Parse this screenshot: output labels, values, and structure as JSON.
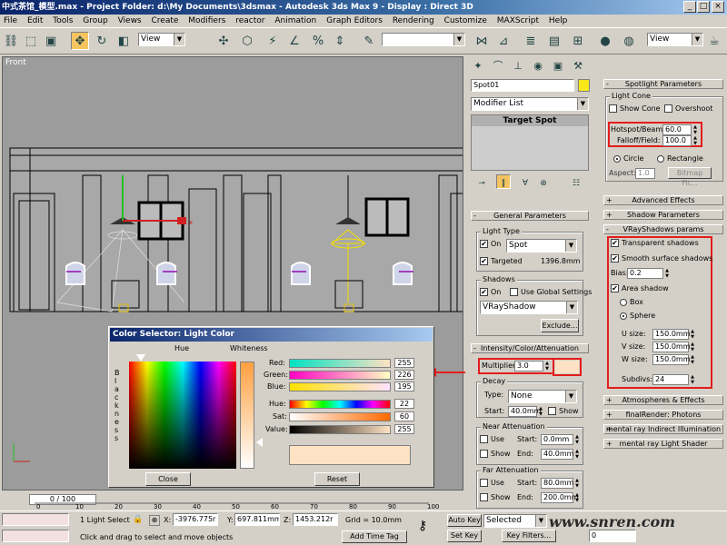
{
  "window": {
    "title": "中式茶馆_模型.max  - Project Folder: d:\\My Documents\\3dsmax   - Autodesk 3ds Max 9    - Display : Direct 3D"
  },
  "menu": [
    "File",
    "Edit",
    "Tools",
    "Group",
    "Views",
    "Create",
    "Modifiers",
    "reactor",
    "Animation",
    "Graph Editors",
    "Rendering",
    "Customize",
    "MAXScript",
    "Help"
  ],
  "toolbar": {
    "view_dropdown": "View",
    "view_dropdown_right": "View"
  },
  "viewport": {
    "label": "Front"
  },
  "command_panel": {
    "object_name": "Spot01",
    "modifier_list": "Modifier List",
    "stack_item": "Target Spot",
    "spotlight_params": {
      "header": "Spotlight Parameters",
      "light_cone": "Light Cone",
      "show_cone": "Show Cone",
      "overshoot": "Overshoot",
      "hotspot_label": "Hotspot/Beam:",
      "hotspot_value": "60.0",
      "falloff_label": "Falloff/Field:",
      "falloff_value": "100.0",
      "circle": "Circle",
      "rectangle": "Rectangle",
      "aspect_label": "Aspect:",
      "aspect_value": "1.0",
      "bitmap_fit": "Bitmap Fit..."
    },
    "advanced_effects": "Advanced Effects",
    "shadow_params": "Shadow Parameters",
    "vray_shadows": {
      "header": "VRayShadows params",
      "transparent": "Transparent shadows",
      "smooth": "Smooth surface shadows",
      "bias_label": "Bias:",
      "bias_value": "0.2",
      "area_shadow": "Area shadow",
      "box": "Box",
      "sphere": "Sphere",
      "u_label": "U size:",
      "u_value": "150.0mm",
      "v_label": "V size:",
      "v_value": "150.0mm",
      "w_label": "W size:",
      "w_value": "150.0mm",
      "subdivs_label": "Subdivs:",
      "subdivs_value": "24"
    },
    "atmospheres": "Atmospheres & Effects",
    "final_render": "finalRender: Photons",
    "mental_ray_indirect": "mental ray Indirect Illumination",
    "mental_ray_shader": "mental ray Light Shader",
    "general_params": {
      "header": "General Parameters",
      "light_type": "Light Type",
      "on": "On",
      "type_value": "Spot",
      "targeted": "Targeted",
      "targeted_dist": "1396.8mm",
      "shadows": "Shadows",
      "shadows_on": "On",
      "use_global": "Use Global Settings",
      "shadow_type": "VRayShadow",
      "exclude": "Exclude..."
    },
    "intensity": {
      "header": "Intensity/Color/Attenuation",
      "multiplier_label": "Multiplier:",
      "multiplier_value": "3.0",
      "swatch_color": "#ffe2c3",
      "decay": "Decay",
      "type_label": "Type:",
      "type_value": "None",
      "start_label": "Start:",
      "start_value": "40.0mm",
      "show": "Show",
      "near_atten": "Near Attenuation",
      "near_use": "Use",
      "near_show": "Show",
      "near_start_label": "Start:",
      "near_start_value": "0.0mm",
      "near_end_label": "End:",
      "near_end_value": "40.0mm",
      "far_atten": "Far Attenuation",
      "far_use": "Use",
      "far_show": "Show",
      "far_start_label": "Start:",
      "far_start_value": "80.0mm",
      "far_end_label": "End:",
      "far_end_value": "200.0mm"
    }
  },
  "color_dialog": {
    "title": "Color Selector: Light Color",
    "hue_label": "Hue",
    "whiteness_label": "Whiteness",
    "blackness_label": "B l a c k n e s s",
    "channels": [
      {
        "name": "Red:",
        "value": "255"
      },
      {
        "name": "Green:",
        "value": "226"
      },
      {
        "name": "Blue:",
        "value": "195"
      },
      {
        "name": "Hue:",
        "value": "22"
      },
      {
        "name": "Sat:",
        "value": "60"
      },
      {
        "name": "Value:",
        "value": "255"
      }
    ],
    "preview_color": "#ffe2c3",
    "close": "Close",
    "reset": "Reset"
  },
  "timeline": {
    "frame": "0 / 100",
    "ticks": [
      "0",
      "10",
      "20",
      "30",
      "40",
      "50",
      "60",
      "70",
      "80",
      "90",
      "100"
    ]
  },
  "status": {
    "selection": "1 Light Select",
    "prompt": "Click and drag to select and move objects",
    "x_label": "X:",
    "x_value": "-3976.775r",
    "y_label": "Y:",
    "y_value": "697.811mm",
    "z_label": "Z:",
    "z_value": "1453.212r",
    "grid": "Grid = 10.0mm",
    "add_time_tag": "Add Time Tag",
    "auto_key": "Auto Key",
    "selected": "Selected",
    "set_key": "Set Key",
    "key_filters": "Key Filters...",
    "frame_field": "0",
    "watermark": "www.snren.com"
  }
}
